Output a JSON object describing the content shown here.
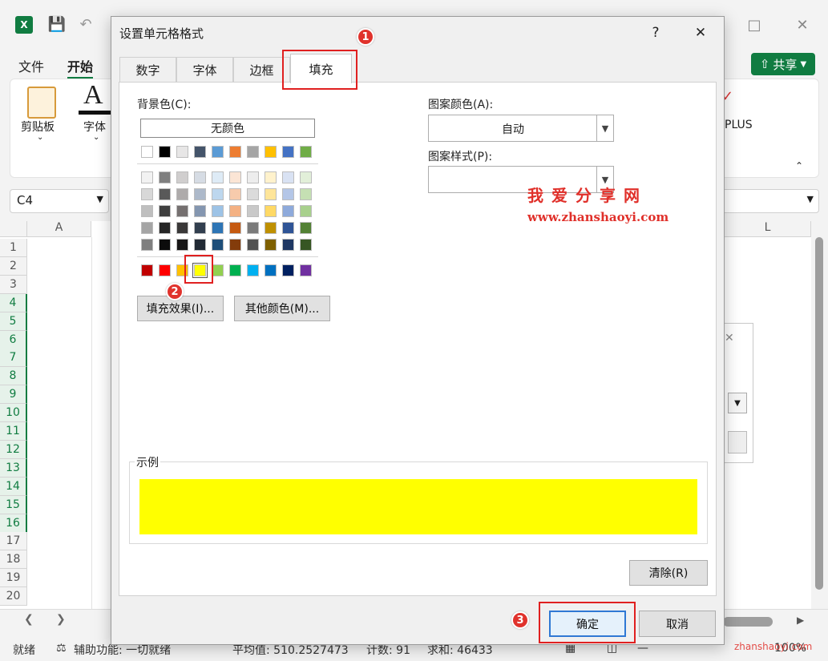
{
  "excel": {
    "logo_text": "X",
    "menu": {
      "file": "文件",
      "home": "开始"
    },
    "share": "共享",
    "ribbon": {
      "clipboard": "剪贴板",
      "font": "字体",
      "plus": "PLUS"
    },
    "name_box": "C4",
    "columns": [
      "A",
      "L"
    ],
    "rows": [
      "1",
      "2",
      "3",
      "4",
      "5",
      "6",
      "7",
      "8",
      "9",
      "10",
      "11",
      "12",
      "13",
      "14",
      "15",
      "16",
      "17",
      "18",
      "19",
      "20"
    ],
    "selected_rows": [
      4,
      5,
      6,
      7,
      8,
      9,
      10,
      11,
      12,
      13,
      14,
      15,
      16
    ],
    "status": {
      "ready": "就绪",
      "accessibility": "辅助功能: 一切就绪",
      "average": "平均值: 510.2527473",
      "count": "计数: 91",
      "sum": "求和: 46433",
      "zoom": "100%"
    }
  },
  "dialog": {
    "title": "设置单元格格式",
    "help": "?",
    "tabs": [
      "数字",
      "字体",
      "边框",
      "填充"
    ],
    "active_tab": "填充",
    "background_color_label": "背景色(C):",
    "no_color": "无颜色",
    "theme_colors_row": [
      "#ffffff",
      "#000000",
      "#e7e6e6",
      "#44546a",
      "#5b9bd5",
      "#ed7d31",
      "#a5a5a5",
      "#ffc000",
      "#4472c4",
      "#70ad47"
    ],
    "tint_rows": [
      [
        "#f2f2f2",
        "#7f7f7f",
        "#d0cece",
        "#d6dce4",
        "#deebf6",
        "#fbe5d5",
        "#ededed",
        "#fff2cc",
        "#d9e2f3",
        "#e2efd9"
      ],
      [
        "#d8d8d8",
        "#595959",
        "#aeabab",
        "#adb9ca",
        "#bdd7ee",
        "#f7cbac",
        "#dbdbdb",
        "#fee599",
        "#b4c6e7",
        "#c5e0b3"
      ],
      [
        "#bfbfbf",
        "#3f3f3f",
        "#757070",
        "#8496b0",
        "#9dc3e6",
        "#f4b183",
        "#c9c9c9",
        "#ffd965",
        "#8eaadb",
        "#a8d08d"
      ],
      [
        "#a5a5a5",
        "#262626",
        "#3a3838",
        "#323f4f",
        "#2e75b5",
        "#c55a11",
        "#7b7b7b",
        "#bf9000",
        "#2f5496",
        "#538135"
      ],
      [
        "#7f7f7f",
        "#0c0c0c",
        "#171616",
        "#222a35",
        "#1e4e79",
        "#833c0b",
        "#525252",
        "#7f6000",
        "#1f3864",
        "#375623"
      ]
    ],
    "standard_colors": [
      "#c00000",
      "#ff0000",
      "#ffc000",
      "#ffff00",
      "#92d050",
      "#00b050",
      "#00b0f0",
      "#0070c0",
      "#002060",
      "#7030a0"
    ],
    "selected_color": "#ffff00",
    "fill_effects": "填充效果(I)...",
    "more_colors": "其他颜色(M)...",
    "pattern_color_label": "图案颜色(A):",
    "pattern_color_value": "自动",
    "pattern_style_label": "图案样式(P):",
    "pattern_style_value": "",
    "sample_label": "示例",
    "clear": "清除(R)",
    "ok": "确定",
    "cancel": "取消"
  },
  "annotations": {
    "step1": "1",
    "step2": "2",
    "step3": "3"
  },
  "watermark": {
    "title": "我爱分享网",
    "url": "www.zhanshaoyi.com",
    "footer": "zhanshaoyi.com"
  }
}
